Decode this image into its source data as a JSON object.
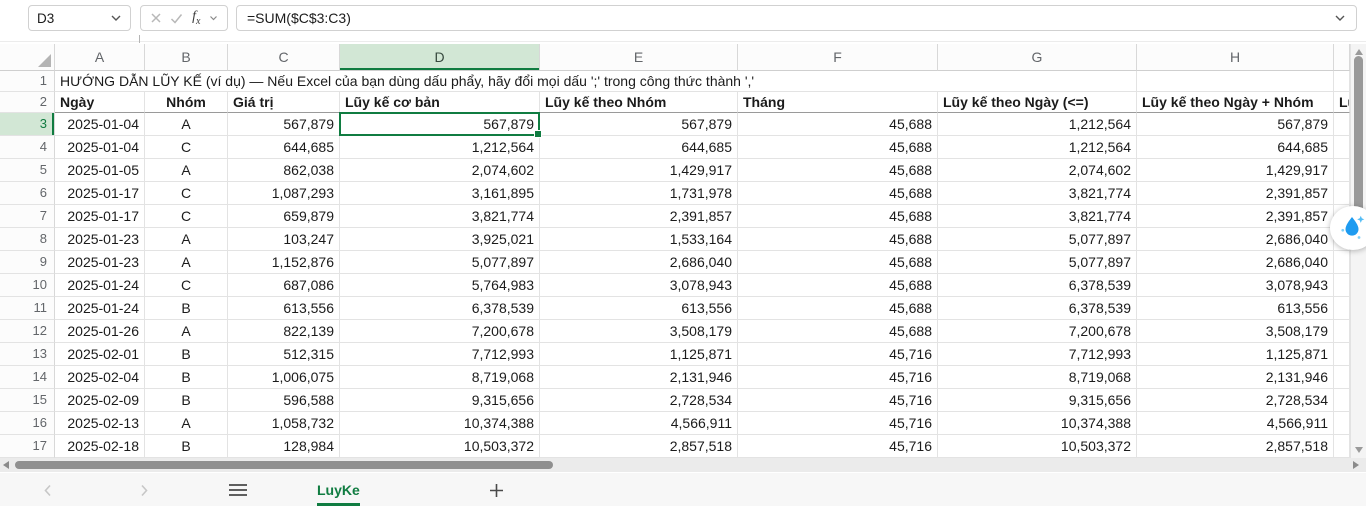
{
  "formula_bar": {
    "name_box_value": "D3",
    "formula": "=SUM($C$3:C3)"
  },
  "icons": {
    "name_box_chevron": "chevron-down",
    "cancel": "x-mark",
    "confirm": "check-mark",
    "insert_function": "fx",
    "fx_chevron": "chevron-down",
    "formula_expand_chevron": "chevron-down",
    "select_all_corner": "triangle",
    "assistant_droplet": "water-drop-sparkle",
    "tab_prev": "chevron-left",
    "tab_next": "chevron-right",
    "all_sheets": "hamburger",
    "add_sheet": "plus"
  },
  "colors": {
    "accent_green": "#107c41",
    "selection_fill": "#d2e7d5",
    "droplet_blue": "#1e9bf0",
    "scroll_thumb": "#8f8f8f"
  },
  "sheet": {
    "column_letters": [
      "A",
      "B",
      "C",
      "D",
      "E",
      "F",
      "G",
      "H"
    ],
    "selected_column": "D",
    "selected_row_number": 3,
    "partial_column_header_text": "Lũ",
    "note_row_number": "1",
    "note_text": "HƯỚNG DẪN LŨY KẾ (ví dụ) — Nếu Excel của bạn dùng dấu phẩy, hãy đổi mọi dấu ';' trong công thức thành ','",
    "header_row_number": "2",
    "column_headers": [
      "Ngày",
      "Nhóm",
      "Giá trị",
      "Lũy kế cơ bản",
      "Lũy kế theo Nhóm",
      "Tháng",
      "Lũy kế theo Ngày (<=)",
      "Lũy kế theo Ngày + Nhóm"
    ],
    "first_data_row_number": 3,
    "rows": [
      [
        "2025-01-04",
        "A",
        "567,879",
        "567,879",
        "567,879",
        "45,688",
        "1,212,564",
        "567,879"
      ],
      [
        "2025-01-04",
        "C",
        "644,685",
        "1,212,564",
        "644,685",
        "45,688",
        "1,212,564",
        "644,685"
      ],
      [
        "2025-01-05",
        "A",
        "862,038",
        "2,074,602",
        "1,429,917",
        "45,688",
        "2,074,602",
        "1,429,917"
      ],
      [
        "2025-01-17",
        "C",
        "1,087,293",
        "3,161,895",
        "1,731,978",
        "45,688",
        "3,821,774",
        "2,391,857"
      ],
      [
        "2025-01-17",
        "C",
        "659,879",
        "3,821,774",
        "2,391,857",
        "45,688",
        "3,821,774",
        "2,391,857"
      ],
      [
        "2025-01-23",
        "A",
        "103,247",
        "3,925,021",
        "1,533,164",
        "45,688",
        "5,077,897",
        "2,686,040"
      ],
      [
        "2025-01-23",
        "A",
        "1,152,876",
        "5,077,897",
        "2,686,040",
        "45,688",
        "5,077,897",
        "2,686,040"
      ],
      [
        "2025-01-24",
        "C",
        "687,086",
        "5,764,983",
        "3,078,943",
        "45,688",
        "6,378,539",
        "3,078,943"
      ],
      [
        "2025-01-24",
        "B",
        "613,556",
        "6,378,539",
        "613,556",
        "45,688",
        "6,378,539",
        "613,556"
      ],
      [
        "2025-01-26",
        "A",
        "822,139",
        "7,200,678",
        "3,508,179",
        "45,688",
        "7,200,678",
        "3,508,179"
      ],
      [
        "2025-02-01",
        "B",
        "512,315",
        "7,712,993",
        "1,125,871",
        "45,716",
        "7,712,993",
        "1,125,871"
      ],
      [
        "2025-02-04",
        "B",
        "1,006,075",
        "8,719,068",
        "2,131,946",
        "45,716",
        "8,719,068",
        "2,131,946"
      ],
      [
        "2025-02-09",
        "B",
        "596,588",
        "9,315,656",
        "2,728,534",
        "45,716",
        "9,315,656",
        "2,728,534"
      ],
      [
        "2025-02-13",
        "A",
        "1,058,732",
        "10,374,388",
        "4,566,911",
        "45,716",
        "10,374,388",
        "4,566,911"
      ],
      [
        "2025-02-18",
        "B",
        "128,984",
        "10,503,372",
        "2,857,518",
        "45,716",
        "10,503,372",
        "2,857,518"
      ]
    ]
  },
  "tab_bar": {
    "active_tab": "LuyKe"
  }
}
